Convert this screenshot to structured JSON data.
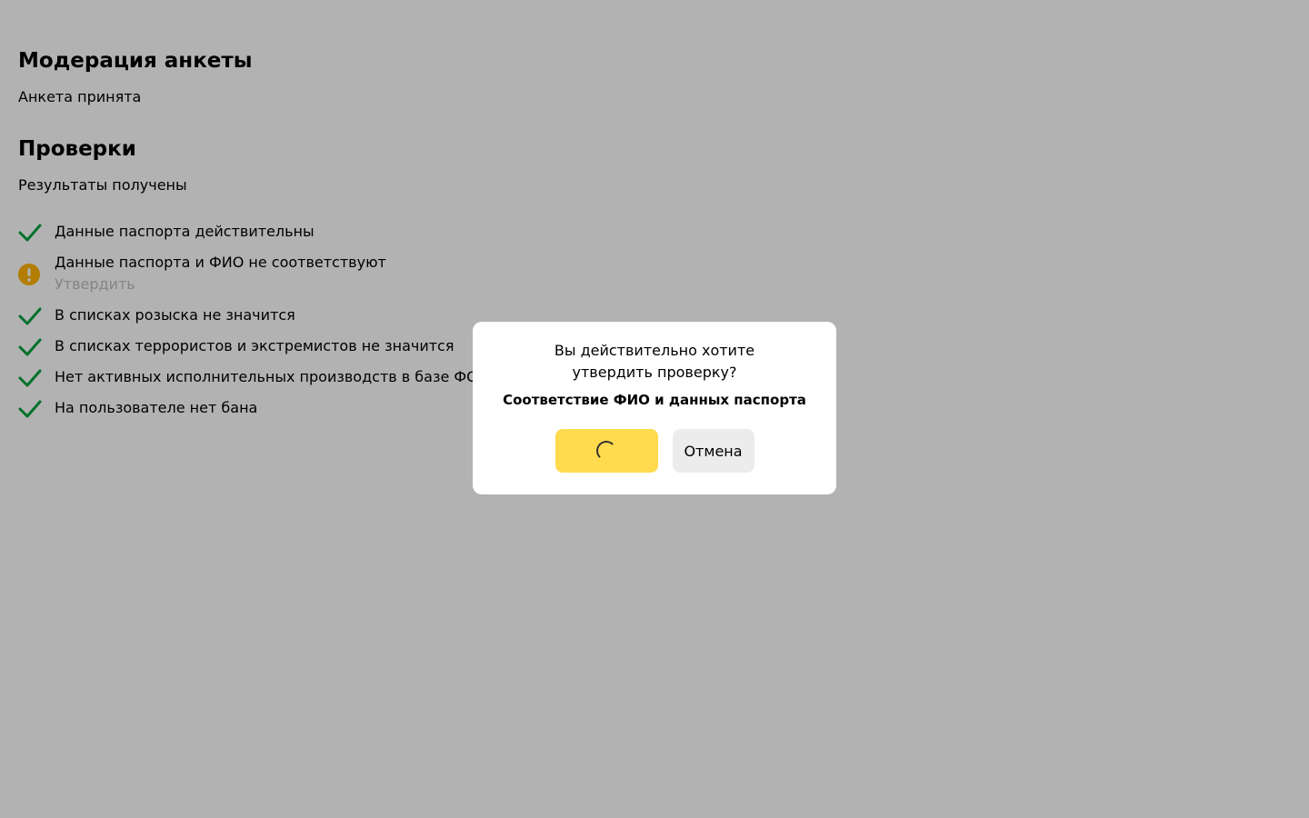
{
  "moderation": {
    "title": "Модерация анкеты",
    "status": "Анкета принята"
  },
  "checks": {
    "title": "Проверки",
    "status": "Результаты получены",
    "items": [
      {
        "label": "Данные паспорта действительны",
        "icon": "checkmark-icon",
        "state": "ok"
      },
      {
        "label": "Данные паспорта и ФИО не соответствуют",
        "icon": "warning-icon",
        "state": "warning",
        "action_label": "Утвердить"
      },
      {
        "label": "В списках розыска не значится",
        "icon": "checkmark-icon",
        "state": "ok"
      },
      {
        "label": "В списках террористов и экстремистов не значится",
        "icon": "checkmark-icon",
        "state": "ok"
      },
      {
        "label": "Нет активных исполнительных производств в базе ФССП",
        "icon": "checkmark-icon",
        "state": "ok"
      },
      {
        "label": "На пользователе нет бана",
        "icon": "checkmark-icon",
        "state": "ok"
      }
    ]
  },
  "dialog": {
    "question": "Вы действительно хотите утвердить проверку?",
    "subject": "Соответствие ФИО и данных паспорта",
    "confirm_state": "loading",
    "cancel_label": "Отмена"
  },
  "colors": {
    "ok": "#00a23e",
    "warning": "#ffb300",
    "confirm_button": "#ffdb4d",
    "cancel_button": "#ececec",
    "overlay": "rgba(0,0,0,0.3)"
  }
}
